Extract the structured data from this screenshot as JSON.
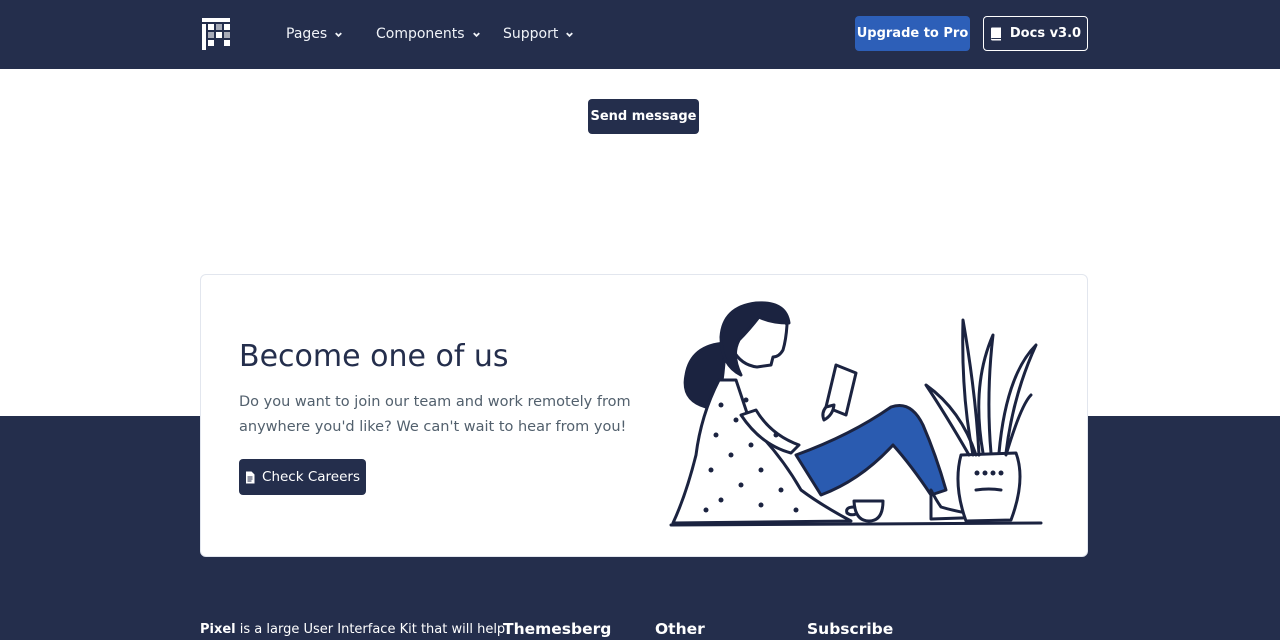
{
  "nav": {
    "logo_icon": "pixel-logo",
    "items": [
      {
        "label": "Pages",
        "icon": "chevron-down"
      },
      {
        "label": "Components",
        "icon": "chevron-down"
      },
      {
        "label": "Support",
        "icon": "chevron-down"
      }
    ],
    "upgrade_label": "Upgrade to Pro",
    "docs_label": "Docs v3.0",
    "docs_icon": "book-icon"
  },
  "contact": {
    "send_label": "Send message"
  },
  "careers": {
    "title": "Become one of us",
    "text": "Do you want to join our team and work remotely from anywhere you'd like? We can't wait to hear from you!",
    "button_label": "Check Careers",
    "button_icon": "document-icon"
  },
  "footer": {
    "brand_name": "Pixel",
    "brand_text": " is a large User Interface Kit that will help",
    "columns": [
      "Themesberg",
      "Other",
      "Subscribe"
    ]
  },
  "colors": {
    "primary_dark": "#242e4c",
    "accent_blue": "#2d5fb8",
    "illustration_blue": "#2a5bb0"
  }
}
